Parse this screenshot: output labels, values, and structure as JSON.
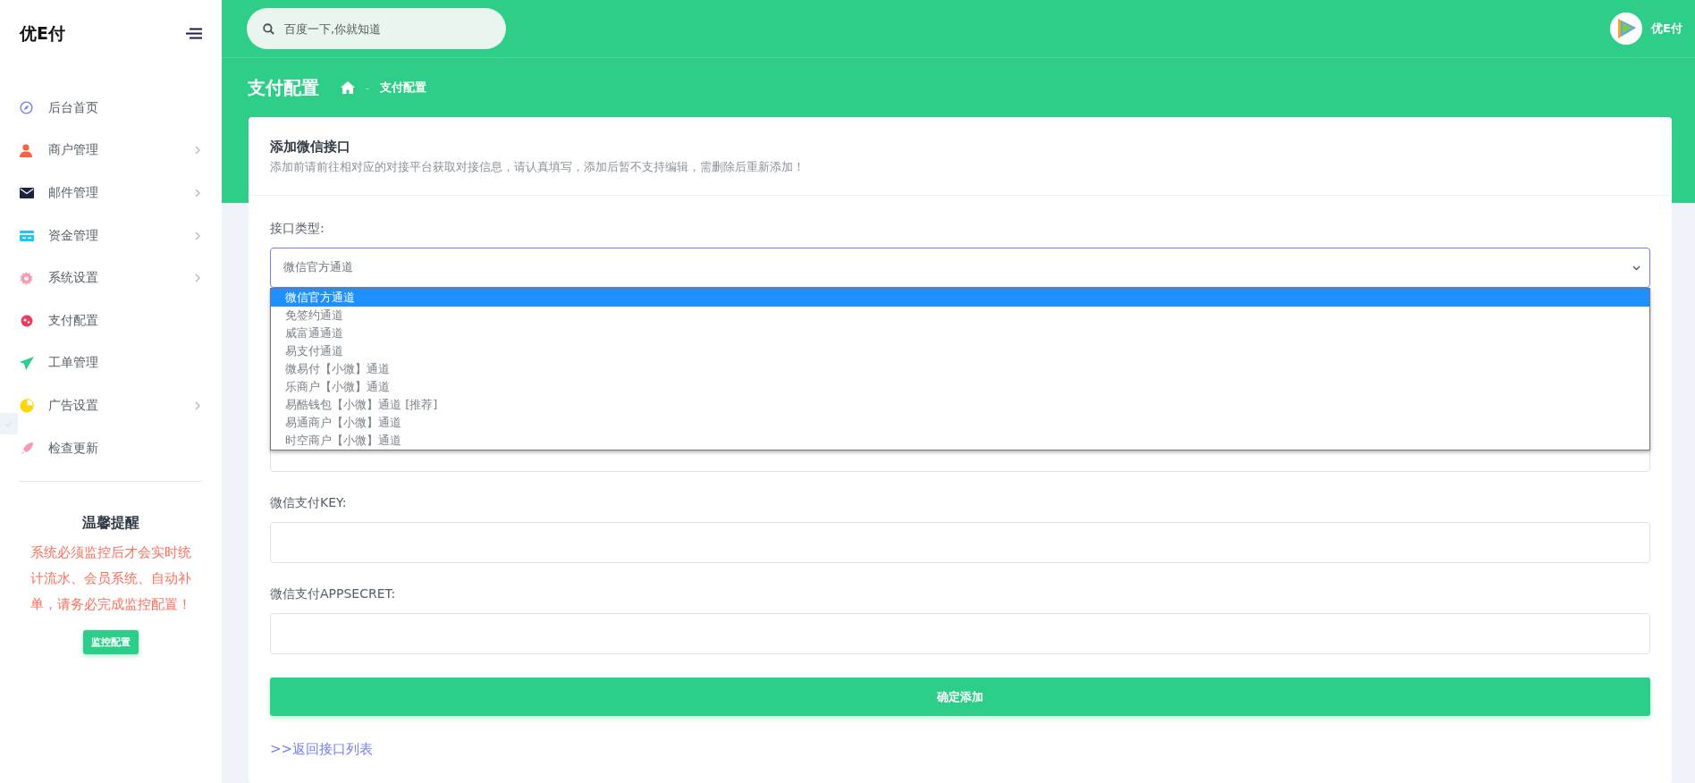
{
  "sidebar": {
    "logo": "优E付",
    "items": [
      {
        "label": "后台首页",
        "expandable": false
      },
      {
        "label": "商户管理",
        "expandable": true
      },
      {
        "label": "邮件管理",
        "expandable": true
      },
      {
        "label": "资金管理",
        "expandable": true
      },
      {
        "label": "系统设置",
        "expandable": true
      },
      {
        "label": "支付配置",
        "expandable": false
      },
      {
        "label": "工单管理",
        "expandable": false
      },
      {
        "label": "广告设置",
        "expandable": true
      },
      {
        "label": "检查更新",
        "expandable": false
      }
    ],
    "notice": {
      "title": "温馨提醒",
      "text": "系统必须监控后才会实时统计流水、会员系统、自动补单，请务必完成监控配置！",
      "button": "监控配置"
    }
  },
  "topbar": {
    "search": {
      "placeholder": "百度一下,你就知道"
    },
    "user": "优E付"
  },
  "page": {
    "title": "支付配置",
    "separator": "-",
    "breadcrumb": [
      "支付配置"
    ]
  },
  "card": {
    "title": "添加微信接口",
    "subtitle": "添加前请前往相对应的对接平台获取对接信息，请认真填写，添加后暂不支持编辑，需删除后重新添加！",
    "type_field": {
      "label": "接口类型:",
      "value": "微信官方通道",
      "expanded": true,
      "options": [
        {
          "label": "微信官方通道",
          "selected": true
        },
        {
          "label": "免签约通道",
          "selected": false
        },
        {
          "label": "威富通通道",
          "selected": false
        },
        {
          "label": "易支付通道",
          "selected": false
        },
        {
          "label": "微易付【小微】通道",
          "selected": false
        },
        {
          "label": "乐商户【小微】通道",
          "selected": false
        },
        {
          "label": "易酷钱包【小微】通道 [推荐]",
          "selected": false
        },
        {
          "label": "易通商户【小微】通道",
          "selected": false
        },
        {
          "label": "时空商户【小微】通道",
          "selected": false
        }
      ]
    },
    "fields": [
      {
        "label": "微信支付KEY:"
      },
      {
        "label": "微信支付APPSECRET:"
      }
    ],
    "submit": "确定添加",
    "back_link": ">>返回接口列表"
  }
}
